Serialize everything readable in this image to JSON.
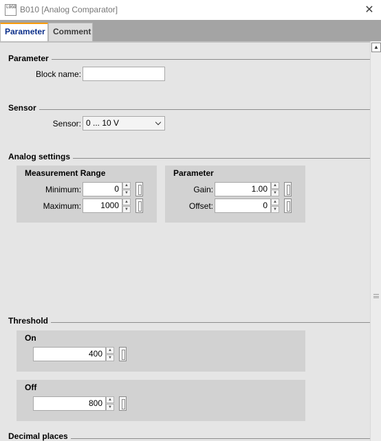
{
  "window": {
    "icon_text": "LOGO",
    "title": "B010 [Analog Comparator]",
    "close": "✕"
  },
  "tabs": [
    {
      "label": "Parameter",
      "active": true
    },
    {
      "label": "Comment",
      "active": false
    }
  ],
  "parameter_section": {
    "title": "Parameter",
    "block_name_label": "Block name:",
    "block_name_value": ""
  },
  "sensor_section": {
    "title": "Sensor",
    "sensor_label": "Sensor:",
    "sensor_value": "0 ... 10 V"
  },
  "analog_section": {
    "title": "Analog settings",
    "measurement_range": {
      "title": "Measurement Range",
      "minimum_label": "Minimum:",
      "minimum_value": "0",
      "maximum_label": "Maximum:",
      "maximum_value": "1000"
    },
    "parameter": {
      "title": "Parameter",
      "gain_label": "Gain:",
      "gain_value": "1.00",
      "offset_label": "Offset:",
      "offset_value": "0"
    }
  },
  "threshold_section": {
    "title": "Threshold",
    "on": {
      "title": "On",
      "value": "400"
    },
    "off": {
      "title": "Off",
      "value": "800"
    }
  },
  "decimal_section": {
    "title": "Decimal places"
  },
  "icons": {
    "spin_up": "▲",
    "spin_down": "▼",
    "scroll_up": "▲"
  }
}
